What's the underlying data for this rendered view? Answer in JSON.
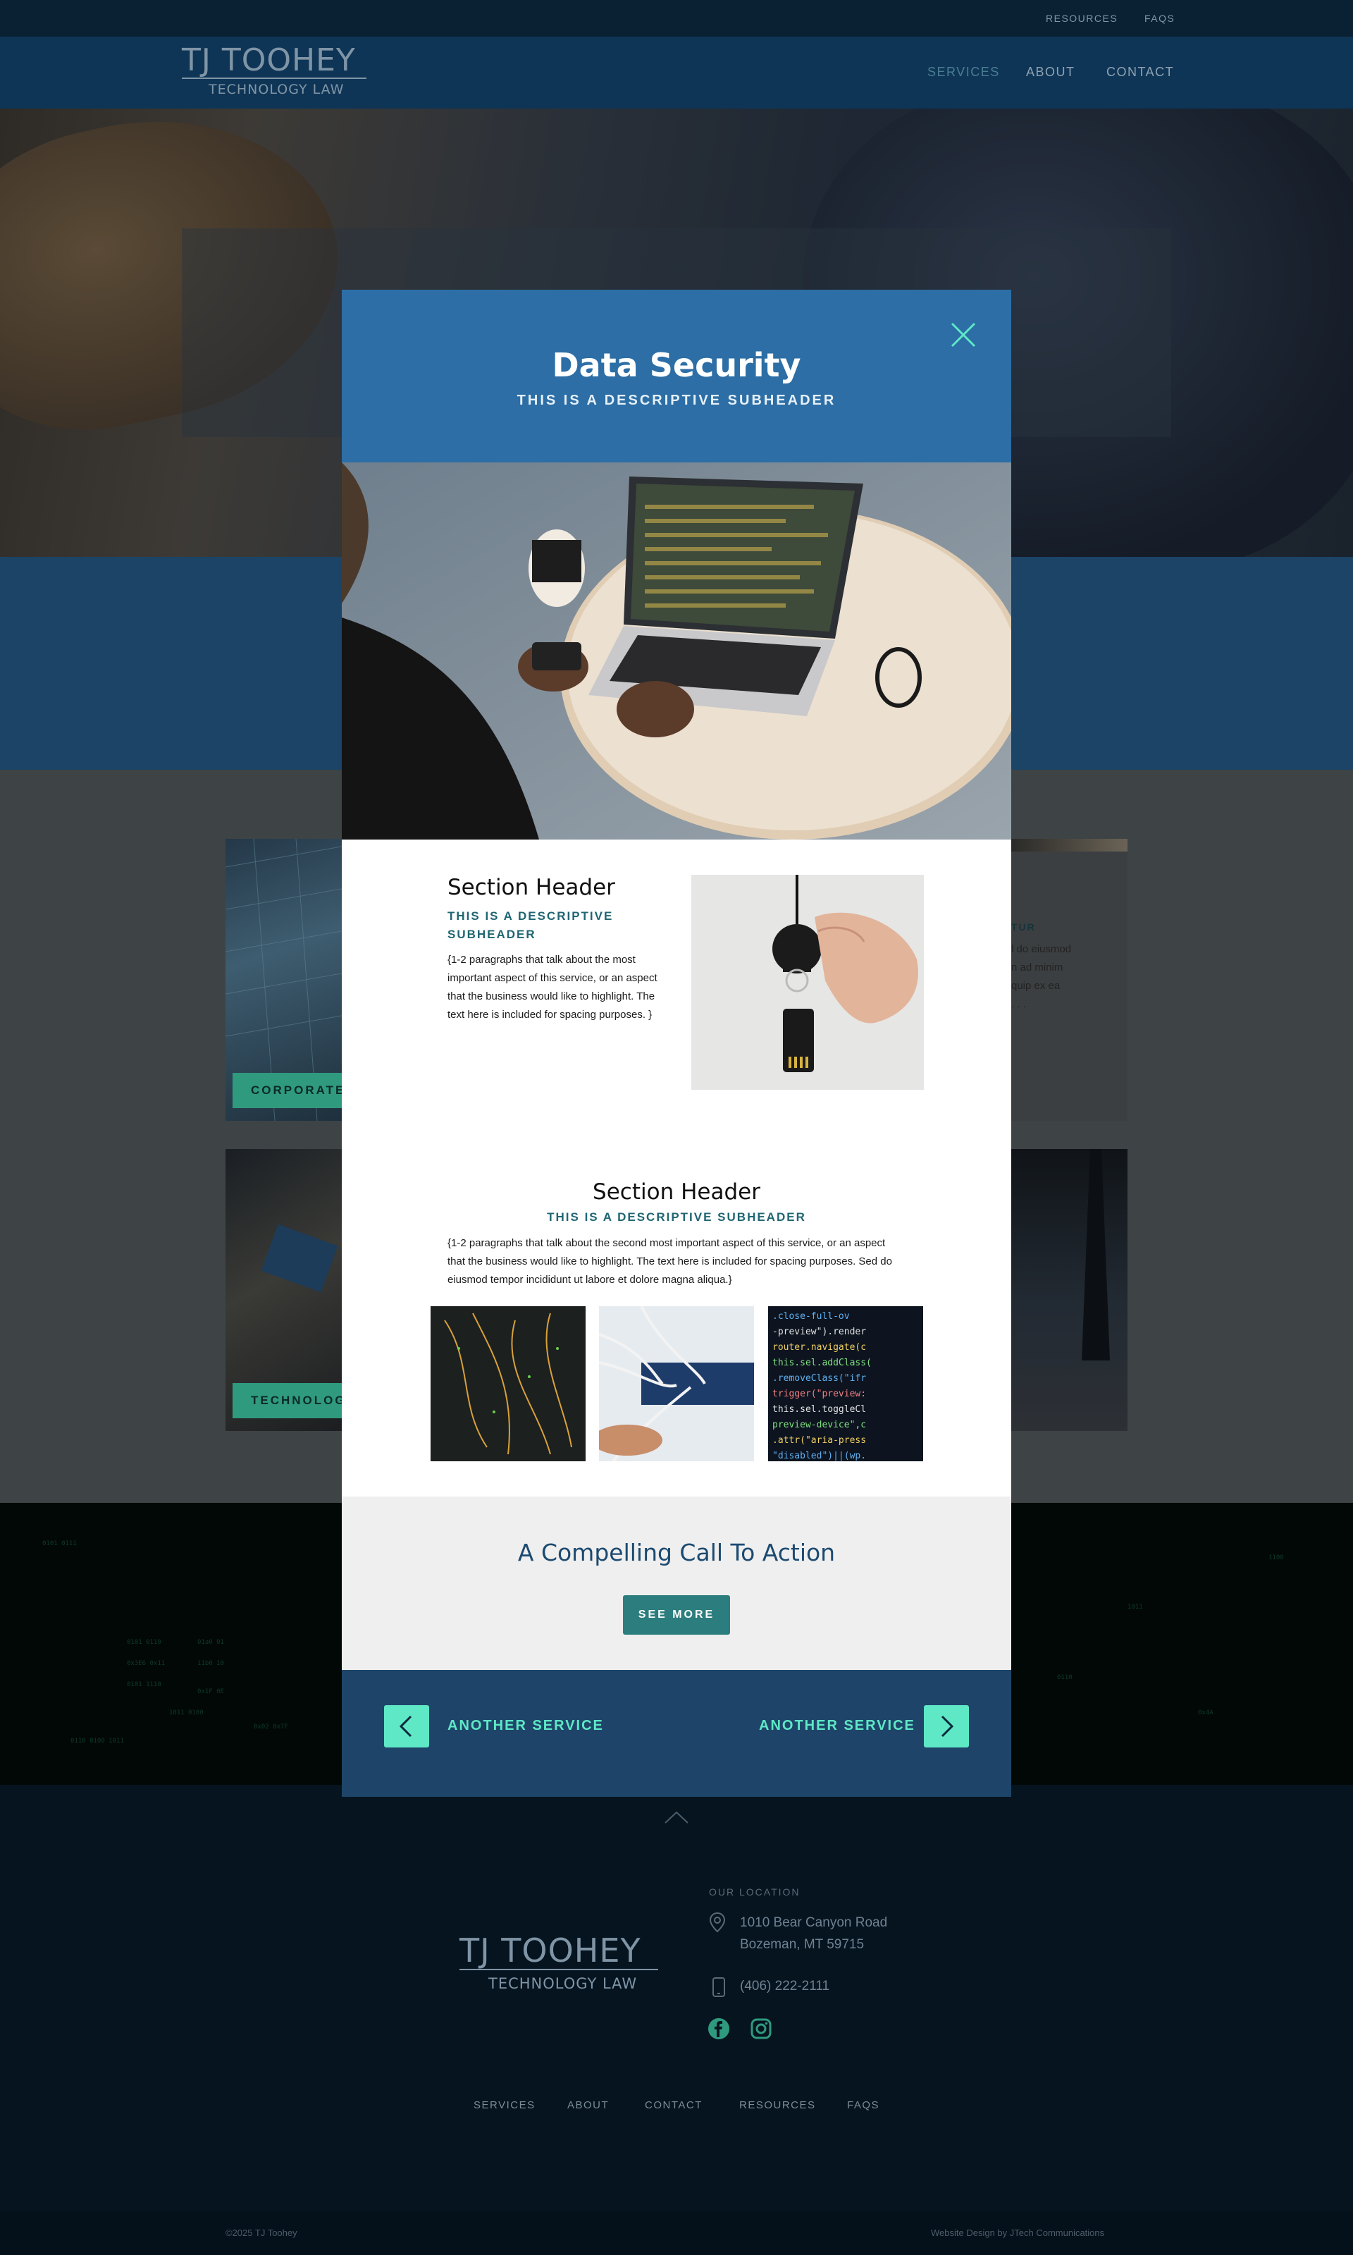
{
  "topbar": {
    "resources": "RESOURCES",
    "faqs": "FAQS"
  },
  "header": {
    "logo_main": "TJ TOOHEY",
    "logo_sub": "TECHNOLOGY LAW",
    "nav": [
      "SERVICES",
      "ABOUT",
      "CONTACT"
    ],
    "active_nav": "SERVICES"
  },
  "background_cards": {
    "corporate_label": "CORPORATE",
    "technology_label": "TECHNOLOGY",
    "right_subhead": "TUR",
    "right_text": [
      "l do eiusmod",
      "n ad minim",
      "quip ex ea",
      ". . ."
    ]
  },
  "modal": {
    "title": "Data Security",
    "subheader": "THIS IS A DESCRIPTIVE SUBHEADER",
    "section1": {
      "header": "Section Header",
      "subheader": "THIS IS A DESCRIPTIVE SUBHEADER",
      "body": "{1-2 paragraphs that talk about the most important aspect of this service, or an aspect that the business would like to highlight. The text here is included for spacing purposes. }"
    },
    "section2": {
      "header": "Section Header",
      "subheader": "THIS IS A DESCRIPTIVE SUBHEADER",
      "body": "{1-2 paragraphs that talk about the second most important aspect of this service, or an aspect that the business would like to highlight. The text here is included for spacing purposes. Sed do eiusmod tempor incididunt ut labore et dolore magna aliqua.}"
    },
    "cta": {
      "title": "A Compelling Call To Action",
      "button": "SEE MORE"
    },
    "footer_nav": {
      "prev_label": "ANOTHER SERVICE",
      "next_label": "ANOTHER SERVICE"
    }
  },
  "footer": {
    "logo_main": "TJ TOOHEY",
    "logo_sub": "TECHNOLOGY LAW",
    "location_label": "OUR LOCATION",
    "address_line1": "1010 Bear Canyon Road",
    "address_line2": "Bozeman, MT 59715",
    "phone": "(406) 222-2111",
    "nav": [
      "SERVICES",
      "ABOUT",
      "CONTACT",
      "RESOURCES",
      "FAQS"
    ],
    "copyright": "©2025 TJ Toohey",
    "credit": "Website Design by JTech Communications"
  },
  "colors": {
    "brand_blue": "#2c6ea5",
    "accent_mint": "#5ee8c6",
    "teal_button": "#2c7d7d",
    "navy": "#1e4569"
  }
}
